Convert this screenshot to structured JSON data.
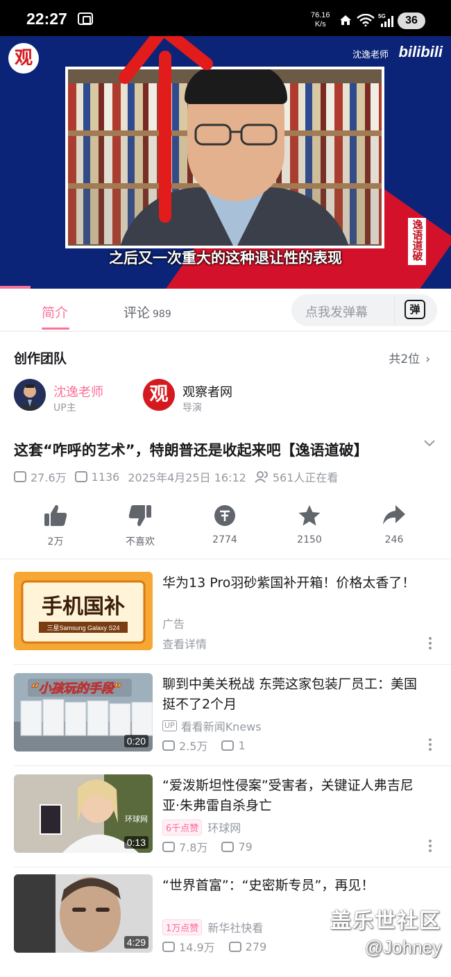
{
  "status_bar": {
    "time": "22:27",
    "speed_value": "76.16",
    "speed_unit": "K/s",
    "network": "5G",
    "battery": "36"
  },
  "video": {
    "channel_logo": "观",
    "author_watermark": "沈逸老师",
    "platform_logo": "bilibili",
    "subtitle": "之后又一次重大的这种退让性的表现",
    "vertical_tag": "逸语道破",
    "accent_color": "#fb7299"
  },
  "tabs": {
    "intro": "简介",
    "comments": "评论",
    "comments_count": "989",
    "danmaku_placeholder": "点我发弹幕",
    "danmaku_button": "弹"
  },
  "team": {
    "title": "创作团队",
    "count": "共2位",
    "members": [
      {
        "name": "沈逸老师",
        "role": "UP主"
      },
      {
        "name": "观察者网",
        "role": "导演",
        "logo": "观"
      }
    ]
  },
  "video_info": {
    "title": "这套“咋呼的艺术”，特朗普还是收起来吧【逸语道破】",
    "views": "27.6万",
    "danmaku": "1136",
    "date": "2025年4月25日 16:12",
    "watching": "561人正在看"
  },
  "actions": [
    {
      "icon": "thumbs-up-icon",
      "label": "2万"
    },
    {
      "icon": "thumbs-down-icon",
      "label": "不喜欢"
    },
    {
      "icon": "coin-icon",
      "label": "2774"
    },
    {
      "icon": "star-icon",
      "label": "2150"
    },
    {
      "icon": "share-icon",
      "label": "246"
    }
  ],
  "related": [
    {
      "title": "华为13 Pro羽砂紫国补开箱！价格太香了！",
      "ad_label": "广告",
      "ad_link": "查看详情",
      "thumb_text": "手机国补",
      "thumb_sub": "三星Samsung Galaxy S24"
    },
    {
      "title": "聊到中美关税战 东莞这家包装厂员工：美国挺不了2个月",
      "up_badge": "UP",
      "author": "看看新闻Knews",
      "views": "2.5万",
      "danmaku": "1",
      "duration": "0:20",
      "thumb_text": "“小孩玩的手段”"
    },
    {
      "title": "“爱泼斯坦性侵案”受害者，关键证人弗吉尼亚·朱弗雷自杀身亡",
      "badge": "6千点赞",
      "author": "环球网",
      "views": "7.8万",
      "danmaku": "79",
      "duration": "0:13",
      "thumb_text": "环球网"
    },
    {
      "title": "“世界首富”：“史密斯专员”，再见！",
      "badge": "1万点赞",
      "author": "新华社快看",
      "views": "14.9万",
      "danmaku": "279",
      "duration": "4:29"
    }
  ],
  "watermark": {
    "line1": "盖乐世社区",
    "line2": "@Johney"
  }
}
